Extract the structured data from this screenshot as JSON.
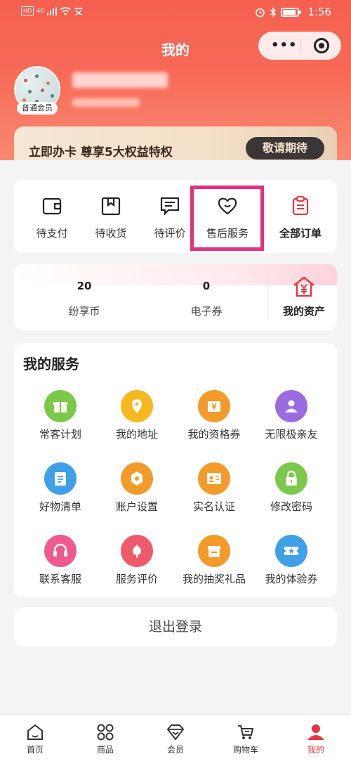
{
  "status_bar": {
    "network": "4G",
    "time": "1:56"
  },
  "header": {
    "title": "我的",
    "more_label": "•••"
  },
  "profile": {
    "member_level": "普通会员"
  },
  "vip_banner": {
    "text": "立即办卡 尊享5大权益特权",
    "button": "敬请期待"
  },
  "orders": [
    {
      "label": "待支付",
      "icon": "wallet-icon"
    },
    {
      "label": "待收货",
      "icon": "package-icon"
    },
    {
      "label": "待评价",
      "icon": "comment-icon"
    },
    {
      "label": "售后服务",
      "icon": "heart-icon"
    },
    {
      "label": "全部订单",
      "icon": "clipboard-icon"
    }
  ],
  "assets": {
    "coins": {
      "value": "20",
      "label": "纷享币"
    },
    "coupons": {
      "value": "0",
      "label": "电子券"
    },
    "my_assets": {
      "label": "我的资产",
      "icon": "yen-house-icon"
    }
  },
  "services": {
    "title": "我的服务",
    "items": [
      {
        "label": "常客计划",
        "icon": "gift-icon",
        "color": "#7cc84a"
      },
      {
        "label": "我的地址",
        "icon": "location-pin-icon",
        "color": "#f6b81f"
      },
      {
        "label": "我的资格券",
        "icon": "ticket-yen-icon",
        "color": "#f29a2a"
      },
      {
        "label": "无限极亲友",
        "icon": "person-icon",
        "color": "#9b6be0"
      },
      {
        "label": "好物清单",
        "icon": "list-icon",
        "color": "#3fa0e8"
      },
      {
        "label": "账户设置",
        "icon": "settings-icon",
        "color": "#f29a2a"
      },
      {
        "label": "实名认证",
        "icon": "id-card-icon",
        "color": "#f29a2a"
      },
      {
        "label": "修改密码",
        "icon": "lock-icon",
        "color": "#7cc84a"
      },
      {
        "label": "联系客服",
        "icon": "headset-icon",
        "color": "#ef5a8e"
      },
      {
        "label": "服务评价",
        "icon": "flower-icon",
        "color": "#ef5a6a"
      },
      {
        "label": "我的抽奖礼品",
        "icon": "gift-box-icon",
        "color": "#f29a2a"
      },
      {
        "label": "我的体验券",
        "icon": "coupon-star-icon",
        "color": "#3fa0e8"
      }
    ]
  },
  "logout": {
    "label": "退出登录"
  },
  "tabbar": [
    {
      "label": "首页",
      "icon": "home-icon"
    },
    {
      "label": "商品",
      "icon": "grid-icon"
    },
    {
      "label": "会员",
      "icon": "diamond-icon"
    },
    {
      "label": "购物车",
      "icon": "cart-icon"
    },
    {
      "label": "我的",
      "icon": "user-icon",
      "active": true
    }
  ],
  "colors": {
    "primary": "#e8343c",
    "header": "#f5604f",
    "highlight": "#e1317c"
  }
}
